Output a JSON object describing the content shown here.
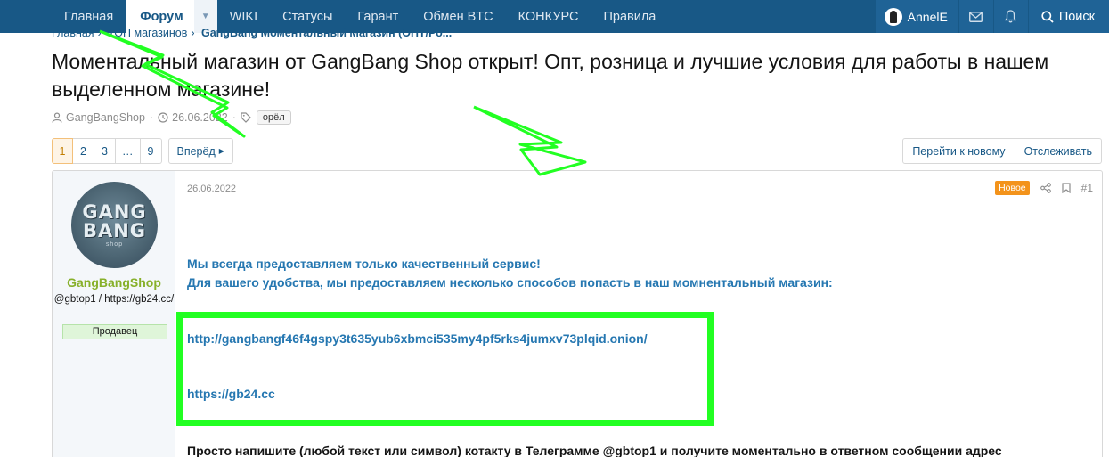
{
  "nav": {
    "tabs": [
      "Главная",
      "Форум",
      "WIKI",
      "Статусы",
      "Гарант",
      "Обмен BTC",
      "КОНКУРС",
      "Правила"
    ],
    "user": "AnnelE",
    "search": "Поиск"
  },
  "breadcrumb": [
    "Главная",
    "ТОП магазинов",
    "GangBang Моментальный Магазин (ОПТ/Ро..."
  ],
  "thread": {
    "title": "Моментальный магазин от GangBang Shop открыт! Опт, розница и лучшие условия для работы в нашем выделенном магазине!",
    "author": "GangBangShop",
    "date": "26.06.2022",
    "tag": "орёл"
  },
  "pager": {
    "pages": [
      "1",
      "2",
      "3",
      "…",
      "9"
    ],
    "current": "1",
    "next": "Вперёд"
  },
  "actions": {
    "goto_new": "Перейти к новому",
    "watch": "Отслеживать"
  },
  "post": {
    "username": "GangBangShop",
    "user_title": "@gbtop1 / https://gb24.cc/",
    "user_badge": "Продавец",
    "date": "26.06.2022",
    "new_badge": "Новое",
    "number": "#1",
    "line1": "Мы всегда предоставляем только качественный сервис!",
    "line2": "Для вашего удобства, мы предоставляем несколько способов попасть в наш момнентальный магазин:",
    "link1": "http://gangbangf46f4gspy3t635yub6xbmci535my4pf5rks4jumxv73plqid.onion/",
    "link2": "https://gb24.cc",
    "line3": "Просто напишите (любой текст или символ) котакту в Телеграмме @gbtop1 и получите моментально в ответном сообщении адрес",
    "avatar_text": [
      "GANG",
      "BANG",
      "shop"
    ]
  },
  "colors": {
    "nav_bg": "#185886",
    "link": "#2577b1",
    "username": "#87b02a",
    "new_badge": "#f3931b",
    "annotation": "#22ff22"
  }
}
